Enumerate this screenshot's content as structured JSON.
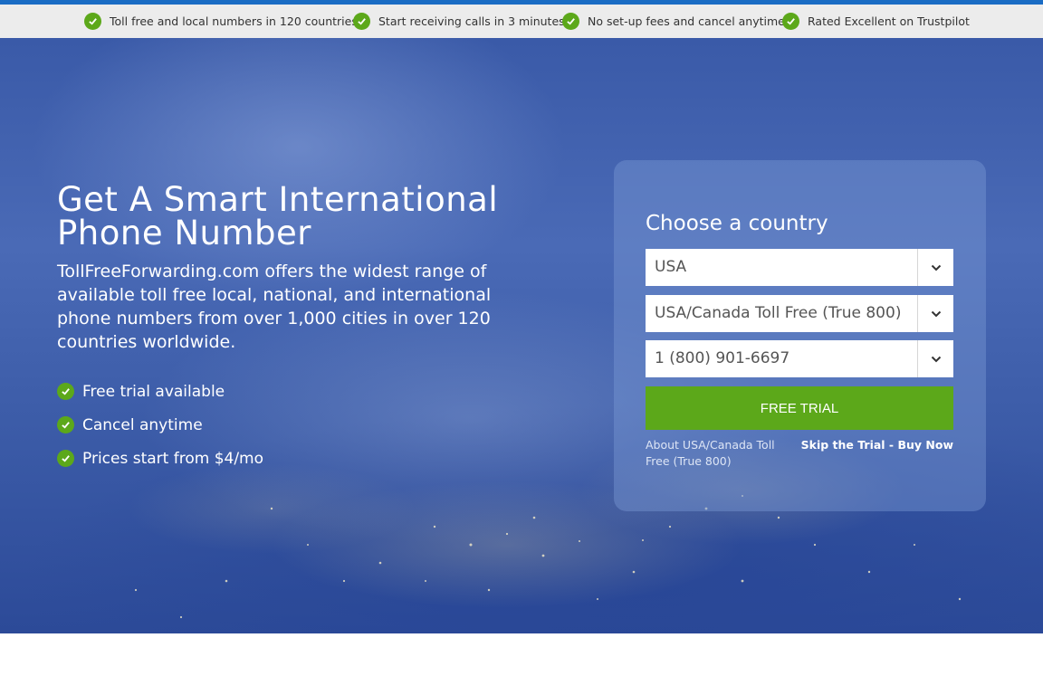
{
  "benefits_bar": {
    "items": [
      {
        "label": "Toll free and local numbers in 120 countries"
      },
      {
        "label": "Start receiving calls in 3 minutes"
      },
      {
        "label": "No set-up fees and cancel anytime"
      },
      {
        "label": "Rated Excellent on Trustpilot"
      }
    ]
  },
  "hero": {
    "headline_line1": "Get A Smart International",
    "headline_line2": "Phone Number",
    "lead": "TollFreeForwarding.com offers the widest range of available toll free local, national, and international phone numbers from over 1,000 cities in over 120 countries worldwide.",
    "perks": [
      {
        "label": "Free trial available"
      },
      {
        "label": "Cancel anytime"
      },
      {
        "label": "Prices start from $4/mo"
      }
    ]
  },
  "signup_card": {
    "title": "Choose a country",
    "country_select": {
      "value": "USA"
    },
    "type_select": {
      "value": "USA/Canada Toll Free (True 800)"
    },
    "number_select": {
      "value": "1 (800) 901-6697"
    },
    "cta_label": "FREE TRIAL",
    "about_link": "About USA/Canada Toll Free (True 800)",
    "skip_link": "Skip the Trial - Buy Now"
  },
  "colors": {
    "accent_green": "#5ca81a",
    "top_line_blue": "#1a6cc4",
    "benefits_bar_bg": "#ececec"
  },
  "icons": {
    "check": "check-circle-icon",
    "dropdown": "chevron-down-icon"
  }
}
